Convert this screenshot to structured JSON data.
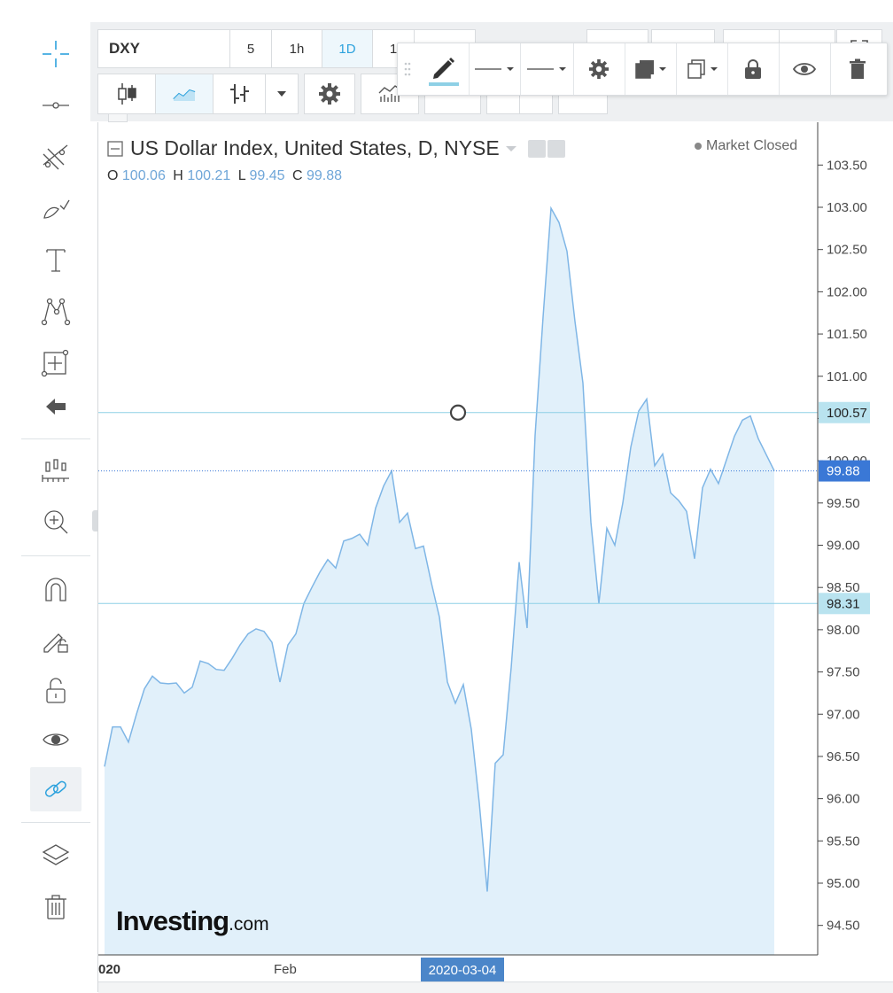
{
  "toolbar": {
    "symbol": "DXY",
    "intervals": [
      "5",
      "1h",
      "1D",
      "1"
    ],
    "active_interval": "1D"
  },
  "chart": {
    "title": "US Dollar Index, United States, D, NYSE",
    "status": "Market Closed",
    "ohlc": {
      "o_label": "O",
      "o": "100.06",
      "h_label": "H",
      "h": "100.21",
      "l_label": "L",
      "l": "99.45",
      "c_label": "C",
      "c": "99.88"
    },
    "price_badges": {
      "upper_line": "100.57",
      "current": "99.88",
      "lower_line": "98.31"
    },
    "crosshair_date": "2020-03-04",
    "x_labels": {
      "left": "020",
      "feb": "Feb"
    },
    "watermark_brand": "Investing",
    "watermark_suffix": ".com",
    "colors": {
      "line": "#7fb6e6",
      "fill": "#e1f0fa",
      "hline": "#8ed0e6",
      "current": "#3a78d6",
      "badge_blue": "#b9e3ef",
      "date_badge": "#4b86c9"
    }
  },
  "chart_data": {
    "type": "area",
    "ylim": [
      94.2,
      103.8
    ],
    "yticks": [
      94.5,
      95.0,
      95.5,
      96.0,
      96.5,
      97.0,
      97.5,
      98.0,
      98.5,
      99.0,
      99.5,
      100.0,
      100.5,
      101.0,
      101.5,
      102.0,
      102.5,
      103.0,
      103.5
    ],
    "ytick_labels": [
      "94.50",
      "95.00",
      "95.50",
      "96.00",
      "96.50",
      "97.00",
      "97.50",
      "98.00",
      "98.50",
      "99.00",
      "99.50",
      "100.00",
      "100.50",
      "101.00",
      "101.50",
      "102.00",
      "102.50",
      "103.00",
      "103.50"
    ],
    "hlines": [
      100.57,
      98.31
    ],
    "current": 99.88,
    "values": [
      96.38,
      96.85,
      96.85,
      96.67,
      97.0,
      97.3,
      97.45,
      97.37,
      97.36,
      97.37,
      97.25,
      97.32,
      97.63,
      97.6,
      97.53,
      97.52,
      97.66,
      97.82,
      97.95,
      98.01,
      97.98,
      97.85,
      97.38,
      97.82,
      97.95,
      98.31,
      98.5,
      98.68,
      98.83,
      98.73,
      99.05,
      99.08,
      99.13,
      99.0,
      99.44,
      99.7,
      99.88,
      99.27,
      99.38,
      98.96,
      98.99,
      98.55,
      98.15,
      97.38,
      97.13,
      97.35,
      96.82,
      95.95,
      94.9,
      96.42,
      96.52,
      97.55,
      98.8,
      98.02,
      100.3,
      101.7,
      102.99,
      102.82,
      102.48,
      101.65,
      100.92,
      99.27,
      98.31,
      99.2,
      99.0,
      99.5,
      100.16,
      100.59,
      100.73,
      99.94,
      100.08,
      99.62,
      99.53,
      99.4,
      98.84,
      99.68,
      99.9,
      99.73,
      100.01,
      100.29,
      100.48,
      100.53,
      100.26,
      100.07,
      99.88
    ]
  }
}
